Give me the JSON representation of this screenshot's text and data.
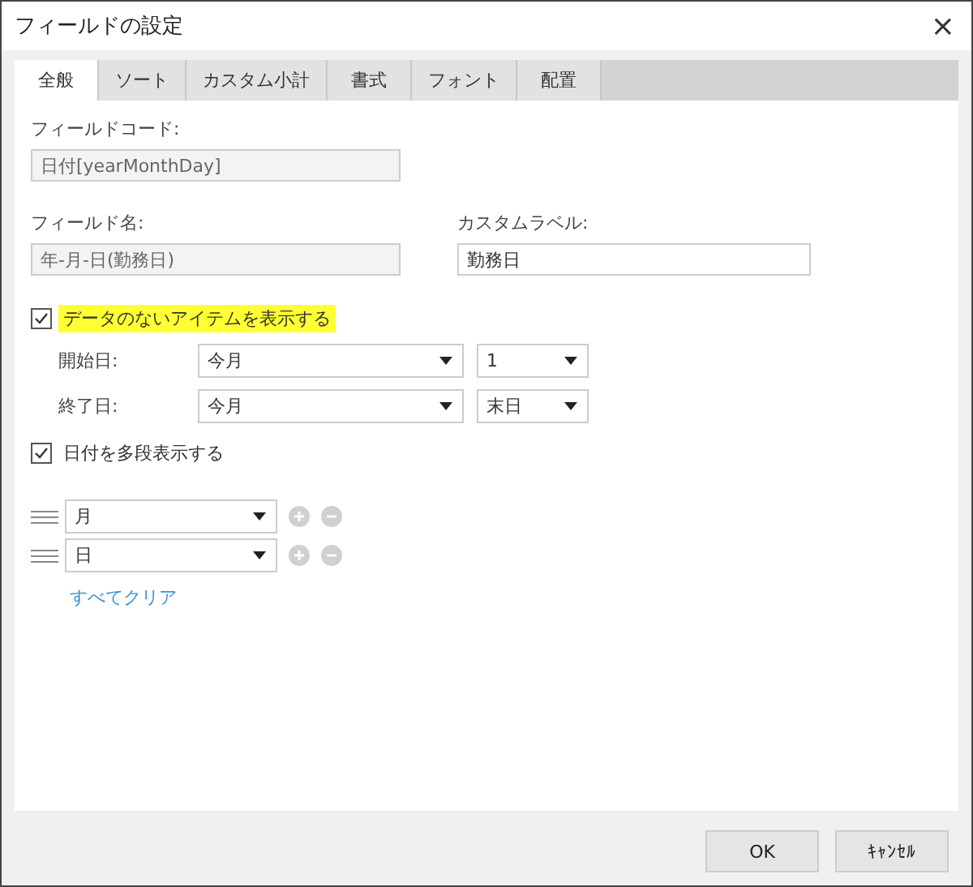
{
  "window": {
    "title": "フィールドの設定",
    "close": "×"
  },
  "tabs": [
    {
      "label": "全般",
      "selected": true
    },
    {
      "label": "ソート",
      "selected": false
    },
    {
      "label": "カスタム小計",
      "selected": false
    },
    {
      "label": "書式",
      "selected": false
    },
    {
      "label": "フォント",
      "selected": false
    },
    {
      "label": "配置",
      "selected": false
    }
  ],
  "field_code": {
    "label": "フィールドコード:",
    "value": "日付[yearMonthDay]",
    "disabled": true
  },
  "field_name": {
    "label": "フィールド名:",
    "value": "年-月-日(勤務日)",
    "disabled": true
  },
  "custom_label": {
    "label": "カスタムラベル:",
    "value": "勤務日",
    "disabled": false
  },
  "show_empty": {
    "label": "データのないアイテムを表示する",
    "checked": true,
    "highlighted": true
  },
  "range": [
    {
      "label": "開始日:",
      "period": "今月",
      "day": "1"
    },
    {
      "label": "終了日:",
      "period": "今月",
      "day": "末日"
    }
  ],
  "multi_level": {
    "label": "日付を多段表示する",
    "checked": true
  },
  "levels": [
    {
      "value": "月"
    },
    {
      "value": "日"
    }
  ],
  "clear_link": "すべてクリア",
  "buttons": [
    "OK",
    "ｷｬﾝｾﾙ"
  ]
}
